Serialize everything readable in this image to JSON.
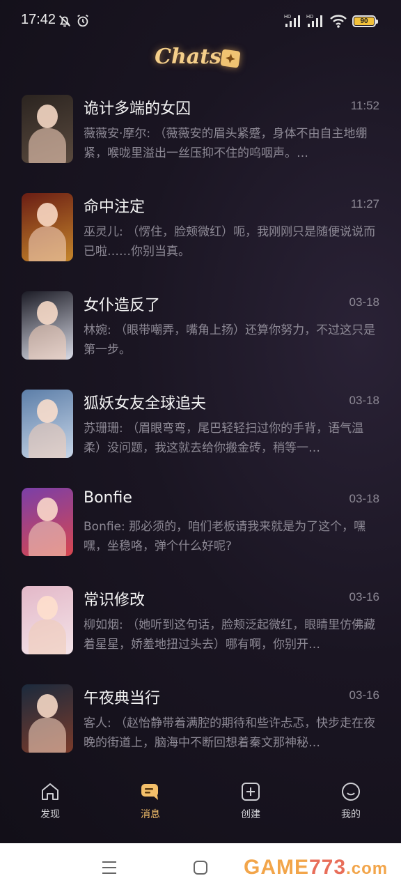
{
  "status_bar": {
    "time": "17:42",
    "battery_level": "90"
  },
  "header": {
    "title": "Chats"
  },
  "chats": [
    {
      "name": "诡计多端的女囚",
      "time": "11:52",
      "preview": "薇薇安·摩尔: （薇薇安的眉头紧蹙，身体不由自主地绷紧，喉咙里溢出一丝压抑不住的呜咽声。…",
      "avatar_colors": [
        "#2b2420",
        "#5a4a3e"
      ]
    },
    {
      "name": "命中注定",
      "time": "11:27",
      "preview": "巫灵儿: （愣住，脸颊微红）呃，我刚刚只是随便说说而已啦……你别当真。",
      "avatar_colors": [
        "#6a1d14",
        "#c5862b"
      ]
    },
    {
      "name": "女仆造反了",
      "time": "03-18",
      "preview": "林婉: （眼带嘲弄，嘴角上扬）还算你努力，不过这只是第一步。",
      "avatar_colors": [
        "#1c1c26",
        "#d9dbe6"
      ]
    },
    {
      "name": "狐妖女友全球追夫",
      "time": "03-18",
      "preview": "苏珊珊: （眉眼弯弯，尾巴轻轻扫过你的手背，语气温柔）没问题，我这就去给你搬金砖，稍等一…",
      "avatar_colors": [
        "#5c7ea8",
        "#c8d6e8"
      ]
    },
    {
      "name": "Bonfie",
      "time": "03-18",
      "preview": "Bonfie: 那必须的，咱们老板请我来就是为了这个，嘿嘿，坐稳咯，弹个什么好呢?",
      "avatar_colors": [
        "#7a3fa8",
        "#d8474f"
      ]
    },
    {
      "name": "常识修改",
      "time": "03-16",
      "preview": "柳如烟: （她听到这句话，脸颊泛起微红，眼睛里仿佛藏着星星，娇羞地扭过头去）哪有啊，你别开…",
      "avatar_colors": [
        "#e3b8c8",
        "#f4e4e9"
      ]
    },
    {
      "name": "午夜典当行",
      "time": "03-16",
      "preview": "客人: （赵怡静带着满腔的期待和些许忐忑，快步走在夜晚的街道上，脑海中不断回想着秦文那神秘…",
      "avatar_colors": [
        "#1b2a3d",
        "#7b3b2a"
      ]
    }
  ],
  "bottom_nav": {
    "items": [
      {
        "label": "发现",
        "icon": "home-icon",
        "active": false
      },
      {
        "label": "消息",
        "icon": "message-icon",
        "active": true
      },
      {
        "label": "创建",
        "icon": "create-icon",
        "active": false
      },
      {
        "label": "我的",
        "icon": "profile-icon",
        "active": false
      }
    ]
  },
  "watermark": {
    "text_game": "GAME",
    "text_num": "773",
    "text_tld": ".com"
  },
  "colors": {
    "accent": "#f3bf6a",
    "background": "#17131f"
  }
}
